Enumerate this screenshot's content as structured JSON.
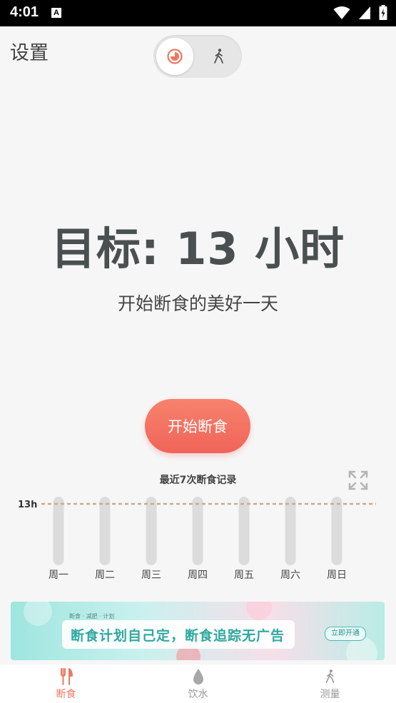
{
  "status_bar": {
    "time": "4:01",
    "notification_badge": "A"
  },
  "header": {
    "settings_label": "设置",
    "mode_toggle": {
      "selected": "fasting",
      "options": [
        "clock-icon",
        "walk-icon"
      ]
    }
  },
  "goal": {
    "title": "目标: 13 小时",
    "subtitle": "开始断食的美好一天"
  },
  "start_button_label": "开始断食",
  "history": {
    "title": "最近7次断食记录",
    "target_label": "13h",
    "days": [
      "周一",
      "周二",
      "周三",
      "周四",
      "周五",
      "周六",
      "周日"
    ]
  },
  "chart_data": {
    "type": "bar",
    "title": "最近7次断食记录",
    "categories": [
      "周一",
      "周二",
      "周三",
      "周四",
      "周五",
      "周六",
      "周日"
    ],
    "values": [
      0,
      0,
      0,
      0,
      0,
      0,
      0
    ],
    "target": 13,
    "target_label": "13h",
    "ylim": [
      0,
      13
    ],
    "grid": false
  },
  "ad": {
    "tag": "断食 · 减肥 · 计划",
    "headline": "断食计划自己定，断食追踪无广告",
    "cta": "立即开通"
  },
  "bottom_nav": [
    {
      "label": "断食",
      "icon": "fork-knife-icon",
      "active": true
    },
    {
      "label": "饮水",
      "icon": "water-drop-icon",
      "active": false
    },
    {
      "label": "测量",
      "icon": "walk-icon",
      "active": false
    }
  ],
  "colors": {
    "accent": "#f06459",
    "goal_text": "#4a4f4f",
    "bar": "#dcdcdc",
    "target_line": "#c8ad8c"
  }
}
